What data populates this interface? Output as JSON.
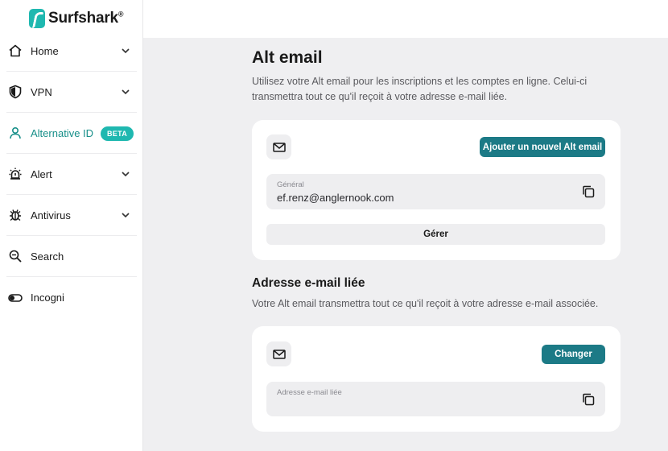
{
  "brand": {
    "name": "Surfshark",
    "reg": "®",
    "color": "#1fb8b0"
  },
  "sidebar": {
    "items": [
      {
        "label": "Home",
        "icon": "home-icon",
        "has_chevron": true
      },
      {
        "label": "VPN",
        "icon": "shield-icon",
        "has_chevron": true
      },
      {
        "label": "Alternative ID",
        "icon": "person-icon",
        "badge": "BETA",
        "active": true
      },
      {
        "label": "Alert",
        "icon": "alert-icon",
        "has_chevron": true
      },
      {
        "label": "Antivirus",
        "icon": "bug-icon",
        "has_chevron": true
      },
      {
        "label": "Search",
        "icon": "search-icon"
      },
      {
        "label": "Incogni",
        "icon": "toggle-icon"
      }
    ]
  },
  "main": {
    "title": "Alt email",
    "description": "Utilisez votre Alt email pour les inscriptions et les comptes en ligne. Celui-ci transmettra tout ce qu'il reçoit à votre adresse e-mail liée.",
    "alt_email_card": {
      "add_button": "Ajouter un nouvel Alt email",
      "field_label": "Général",
      "field_value": "ef.renz@anglernook.com",
      "manage_button": "Gérer"
    },
    "linked_section": {
      "title": "Adresse e-mail liée",
      "description": "Votre Alt email transmettra tout ce qu'il reçoit à votre adresse e-mail associée.",
      "change_button": "Changer",
      "field_label": "Adresse e-mail liée",
      "field_value": ""
    }
  },
  "colors": {
    "accent": "#1c7a86",
    "active_nav": "#178f89",
    "background": "#efeff1"
  }
}
